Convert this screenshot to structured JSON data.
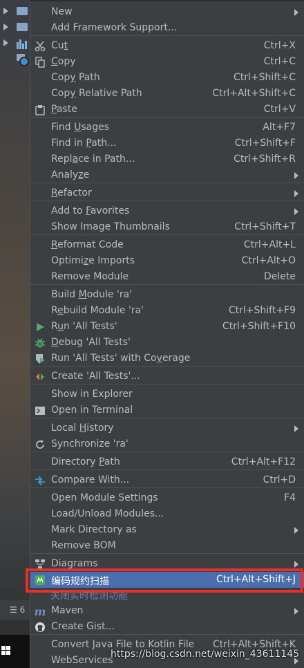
{
  "colors": {
    "menu_bg": "#3c3f41",
    "selection": "#4b6eaf",
    "highlight_border": "#e8302a",
    "text": "#bbbbbb"
  },
  "tree": {
    "bottom_tool_label": "6"
  },
  "menu": {
    "items": [
      {
        "label": "New",
        "shortcut": "",
        "submenu": true,
        "icon": ""
      },
      {
        "label": "Add Framework Support...",
        "shortcut": "",
        "submenu": false,
        "icon": ""
      },
      {
        "label": "Cut",
        "shortcut": "Ctrl+X",
        "submenu": false,
        "icon": "scissors-icon"
      },
      {
        "label": "Copy",
        "shortcut": "Ctrl+C",
        "submenu": false,
        "icon": "copy-icon"
      },
      {
        "label": "Copy Path",
        "shortcut": "Ctrl+Shift+C",
        "submenu": false,
        "icon": ""
      },
      {
        "label": "Copy Relative Path",
        "shortcut": "Ctrl+Alt+Shift+C",
        "submenu": false,
        "icon": ""
      },
      {
        "label": "Paste",
        "shortcut": "Ctrl+V",
        "submenu": false,
        "icon": "paste-icon"
      },
      {
        "label": "Find Usages",
        "shortcut": "Alt+F7",
        "submenu": false,
        "icon": ""
      },
      {
        "label": "Find in Path...",
        "shortcut": "Ctrl+Shift+F",
        "submenu": false,
        "icon": ""
      },
      {
        "label": "Replace in Path...",
        "shortcut": "Ctrl+Shift+R",
        "submenu": false,
        "icon": ""
      },
      {
        "label": "Analyze",
        "shortcut": "",
        "submenu": true,
        "icon": ""
      },
      {
        "label": "Refactor",
        "shortcut": "",
        "submenu": true,
        "icon": ""
      },
      {
        "label": "Add to Favorites",
        "shortcut": "",
        "submenu": true,
        "icon": ""
      },
      {
        "label": "Show Image Thumbnails",
        "shortcut": "Ctrl+Shift+T",
        "submenu": false,
        "icon": ""
      },
      {
        "label": "Reformat Code",
        "shortcut": "Ctrl+Alt+L",
        "submenu": false,
        "icon": ""
      },
      {
        "label": "Optimize Imports",
        "shortcut": "Ctrl+Alt+O",
        "submenu": false,
        "icon": ""
      },
      {
        "label": "Remove Module",
        "shortcut": "Delete",
        "submenu": false,
        "icon": ""
      },
      {
        "label": "Build Module 'ra'",
        "shortcut": "",
        "submenu": false,
        "icon": ""
      },
      {
        "label": "Rebuild Module 'ra'",
        "shortcut": "Ctrl+Shift+F9",
        "submenu": false,
        "icon": ""
      },
      {
        "label": "Run 'All Tests'",
        "shortcut": "Ctrl+Shift+F10",
        "submenu": false,
        "icon": "run-icon"
      },
      {
        "label": "Debug 'All Tests'",
        "shortcut": "",
        "submenu": false,
        "icon": "debug-icon"
      },
      {
        "label": "Run 'All Tests' with Coverage",
        "shortcut": "",
        "submenu": false,
        "icon": "coverage-icon"
      },
      {
        "label": "Create 'All Tests'...",
        "shortcut": "",
        "submenu": false,
        "icon": "create-config-icon"
      },
      {
        "label": "Show in Explorer",
        "shortcut": "",
        "submenu": false,
        "icon": ""
      },
      {
        "label": "Open in Terminal",
        "shortcut": "",
        "submenu": false,
        "icon": "terminal-icon"
      },
      {
        "label": "Local History",
        "shortcut": "",
        "submenu": true,
        "icon": ""
      },
      {
        "label": "Synchronize 'ra'",
        "shortcut": "",
        "submenu": false,
        "icon": "sync-icon"
      },
      {
        "label": "Directory Path",
        "shortcut": "Ctrl+Alt+F12",
        "submenu": false,
        "icon": ""
      },
      {
        "label": "Compare With...",
        "shortcut": "Ctrl+D",
        "submenu": false,
        "icon": "compare-icon"
      },
      {
        "label": "Open Module Settings",
        "shortcut": "F4",
        "submenu": false,
        "icon": ""
      },
      {
        "label": "Load/Unload Modules...",
        "shortcut": "",
        "submenu": false,
        "icon": ""
      },
      {
        "label": "Mark Directory as",
        "shortcut": "",
        "submenu": true,
        "icon": ""
      },
      {
        "label": "Remove BOM",
        "shortcut": "",
        "submenu": false,
        "icon": ""
      },
      {
        "label": "Diagrams",
        "shortcut": "",
        "submenu": true,
        "icon": "diagram-icon"
      },
      {
        "label": "编码规约扫描",
        "shortcut": "Ctrl+Alt+Shift+J",
        "submenu": false,
        "icon": "p3c-scan-icon"
      },
      {
        "label": "Maven",
        "shortcut": "",
        "submenu": true,
        "icon": "maven-icon"
      },
      {
        "label": "Create Gist...",
        "shortcut": "",
        "submenu": false,
        "icon": "github-icon"
      },
      {
        "label": "Convert Java File to Kotlin File",
        "shortcut": "Ctrl+Alt+Shift+K",
        "submenu": false,
        "icon": ""
      },
      {
        "label": "WebServices",
        "shortcut": "",
        "submenu": true,
        "icon": ""
      }
    ],
    "overlap_text": "关闭实时检测功能"
  },
  "watermark": "https://blog.csdn.net/weixin_43611145"
}
